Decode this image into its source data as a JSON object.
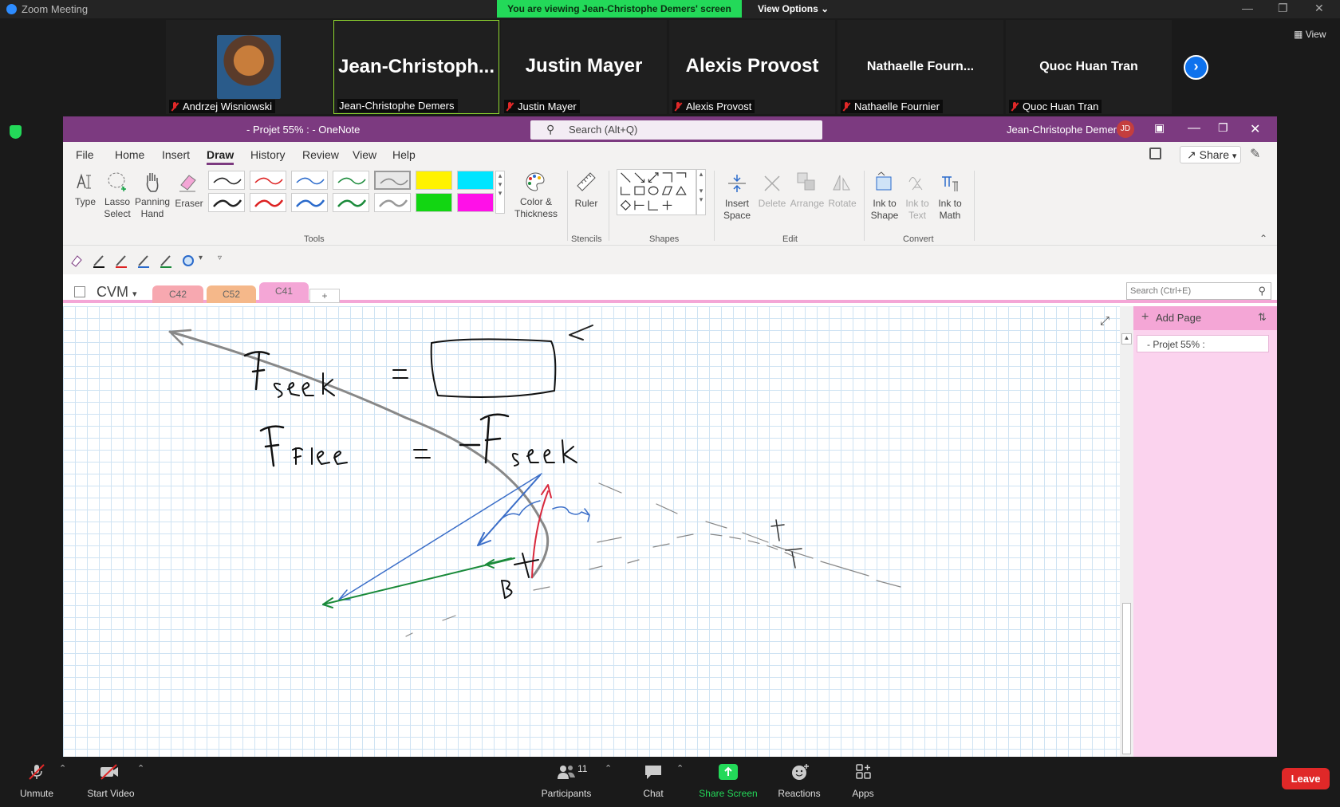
{
  "zoom": {
    "title": "Zoom Meeting",
    "viewing_banner": "You are viewing Jean-Christophe Demers' screen",
    "view_options": "View Options",
    "view_label": "View",
    "participants": [
      {
        "display": "",
        "label": "Andrzej Wisniowski"
      },
      {
        "display": "Jean-Christoph...",
        "label": "Jean-Christophe Demers"
      },
      {
        "display": "Justin Mayer",
        "label": "Justin Mayer"
      },
      {
        "display": "Alexis Provost",
        "label": "Alexis Provost"
      },
      {
        "display": "Nathaelle Fourn...",
        "label": "Nathaelle Fournier"
      },
      {
        "display": "Quoc Huan Tran",
        "label": "Quoc Huan Tran"
      }
    ],
    "bottom": {
      "unmute": "Unmute",
      "start_video": "Start Video",
      "participants": "Participants",
      "participants_count": "11",
      "chat": "Chat",
      "share_screen": "Share Screen",
      "reactions": "Reactions",
      "apps": "Apps",
      "leave": "Leave"
    },
    "colors": {
      "green": "#23d959",
      "blue": "#0e72ed",
      "red": "#e02828"
    }
  },
  "onenote": {
    "doc_title": "- Projet 55% :  -  OneNote",
    "search_placeholder": "Search (Alt+Q)",
    "user": "Jean-Christophe Demers",
    "user_initials": "JD",
    "tabs": [
      "File",
      "Home",
      "Insert",
      "Draw",
      "History",
      "Review",
      "View",
      "Help"
    ],
    "share": "Share",
    "ribbon": {
      "type": "Type",
      "lasso": "Lasso Select",
      "panning": "Panning Hand",
      "eraser": "Eraser",
      "color_thickness": "Color & Thickness",
      "ruler": "Ruler",
      "insert_space": "Insert Space",
      "delete": "Delete",
      "arrange": "Arrange",
      "rotate": "Rotate",
      "ink_to_shape": "Ink to Shape",
      "ink_to_text": "Ink to Text",
      "ink_to_math": "Ink to Math",
      "groups": [
        "Tools",
        "Stencils",
        "Shapes",
        "Edit",
        "Convert"
      ]
    },
    "notebook": "CVM",
    "sections": [
      "C42",
      "C52",
      "C41"
    ],
    "add_section": "+",
    "page_search": "Search (Ctrl+E)",
    "add_page": "Add Page",
    "pages": [
      "- Projet 55% :"
    ],
    "colors": {
      "accent": "#7c3a80",
      "pink": "#f4a6d6"
    }
  }
}
